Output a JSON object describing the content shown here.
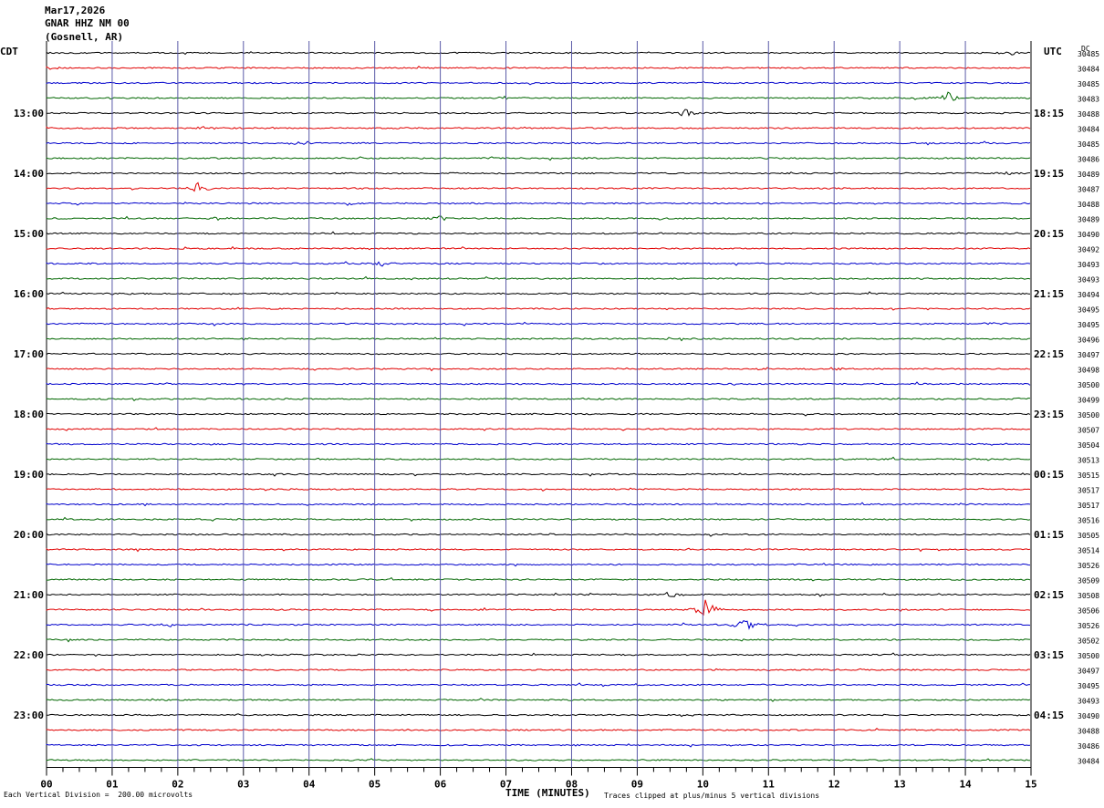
{
  "header": {
    "date": "Mar17,2026",
    "station": "GNAR HHZ NM 00",
    "location": "(Gosnell, AR)",
    "left_tz": "CDT",
    "right_tz": "UTC",
    "dc_label": "DC"
  },
  "footer": {
    "scale_text": "Each Vertical Division =  200.00 microvolts",
    "xlabel": "TIME (MINUTES)",
    "clip_text": "Traces clipped at plus/minus 5 vertical divisions"
  },
  "chart_data": {
    "type": "line",
    "title": "",
    "xlabel": "TIME (MINUTES)",
    "xlim": [
      0,
      15
    ],
    "x_ticks": [
      "00",
      "01",
      "02",
      "03",
      "04",
      "05",
      "06",
      "07",
      "08",
      "09",
      "10",
      "11",
      "12",
      "13",
      "14",
      "15"
    ],
    "trace_colors": [
      "#000000",
      "#e00000",
      "#0000cc",
      "#006600"
    ],
    "grid_color": "#5a5aa8",
    "traces_per_hour": 4,
    "left_hour_labels": [
      "13:00",
      "14:00",
      "15:00",
      "16:00",
      "17:00",
      "18:00",
      "19:00",
      "20:00",
      "21:00",
      "22:00",
      "23:00"
    ],
    "right_hour_labels": [
      "18:15",
      "19:15",
      "20:15",
      "21:15",
      "22:15",
      "23:15",
      "00:15",
      "01:15",
      "02:15",
      "03:15",
      "04:15"
    ],
    "dc_values": [
      "30485",
      "30484",
      "30485",
      "30483",
      "30488",
      "30484",
      "30485",
      "30486",
      "30489",
      "30487",
      "30488",
      "30489",
      "30490",
      "30492",
      "30493",
      "30493",
      "30494",
      "30495",
      "30495",
      "30496",
      "30497",
      "30498",
      "30500",
      "30499",
      "30500",
      "30507",
      "30504",
      "30513",
      "30515",
      "30517",
      "30517",
      "30516",
      "30505",
      "30514",
      "30526",
      "30509",
      "30508",
      "30506",
      "30526",
      "30502",
      "30500",
      "30497",
      "30495",
      "30493",
      "30490",
      "30488",
      "30486",
      "30484"
    ],
    "events": [
      {
        "trace": 0,
        "minute": 14.7,
        "amp": 2
      },
      {
        "trace": 1,
        "minute": 0.1,
        "amp": 1.5
      },
      {
        "trace": 3,
        "minute": 7.0,
        "amp": 1.5
      },
      {
        "trace": 3,
        "minute": 13.75,
        "amp": 8
      },
      {
        "trace": 4,
        "minute": 9.75,
        "amp": 5
      },
      {
        "trace": 5,
        "minute": 2.4,
        "amp": 3
      },
      {
        "trace": 6,
        "minute": 3.8,
        "amp": 2
      },
      {
        "trace": 8,
        "minute": 14.7,
        "amp": 2
      },
      {
        "trace": 9,
        "minute": 2.3,
        "amp": 6
      },
      {
        "trace": 10,
        "minute": 4.6,
        "amp": 2
      },
      {
        "trace": 11,
        "minute": 2.6,
        "amp": 3
      },
      {
        "trace": 11,
        "minute": 6.0,
        "amp": 4
      },
      {
        "trace": 14,
        "minute": 5.1,
        "amp": 3
      },
      {
        "trace": 18,
        "minute": 14.4,
        "amp": 2
      },
      {
        "trace": 21,
        "minute": 12.0,
        "amp": 2
      },
      {
        "trace": 23,
        "minute": 14.8,
        "amp": 2
      },
      {
        "trace": 36,
        "minute": 9.5,
        "amp": 4
      },
      {
        "trace": 37,
        "minute": 10.05,
        "amp": 12
      },
      {
        "trace": 38,
        "minute": 10.65,
        "amp": 8
      },
      {
        "trace": 38,
        "minute": 1.9,
        "amp": 2
      }
    ]
  }
}
